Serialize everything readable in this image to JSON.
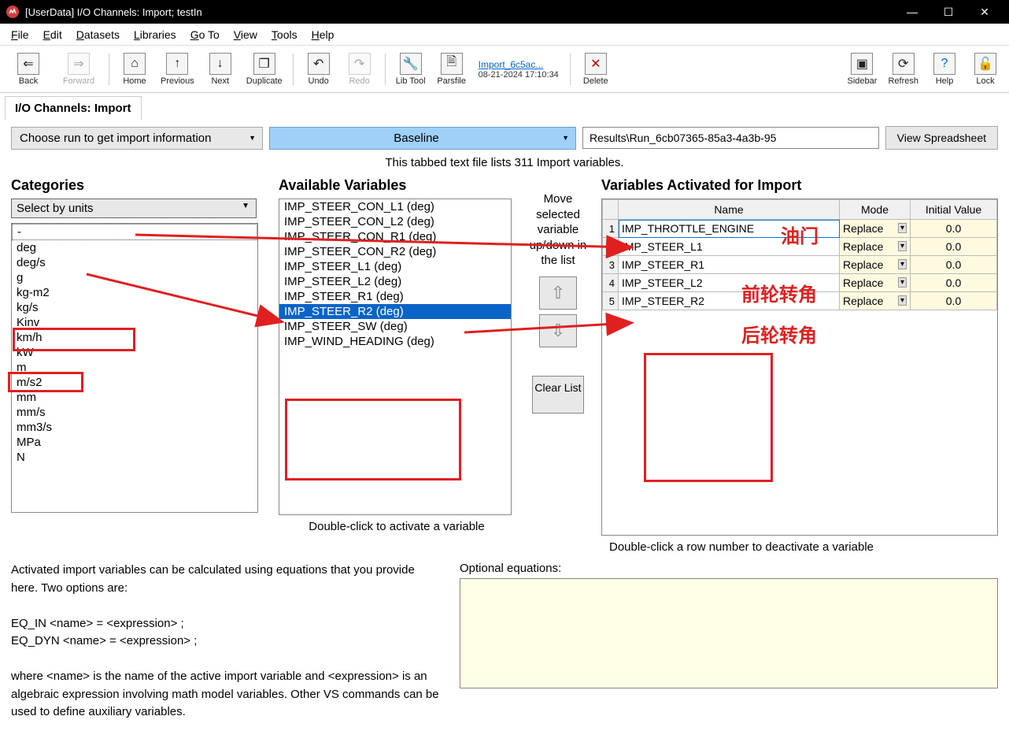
{
  "titlebar": {
    "title": "[UserData] I/O Channels: Import; testIn"
  },
  "menubar": [
    "File",
    "Edit",
    "Datasets",
    "Libraries",
    "Go To",
    "View",
    "Tools",
    "Help"
  ],
  "toolbar": {
    "back": "Back",
    "forward": "Forward",
    "home": "Home",
    "previous": "Previous",
    "next": "Next",
    "duplicate": "Duplicate",
    "undo": "Undo",
    "redo": "Redo",
    "libtool": "Lib Tool",
    "parsfile": "Parsfile",
    "recent_name": "Import_6c5ac...",
    "recent_date": "08-21-2024 17:10:34",
    "delete": "Delete",
    "sidebar": "Sidebar",
    "refresh": "Refresh",
    "help": "Help",
    "lock": "Lock"
  },
  "tab_title": "I/O Channels: Import",
  "top": {
    "choose_run": "Choose run to get import information",
    "baseline": "Baseline",
    "path": "Results\\Run_6cb07365-85a3-4a3b-95",
    "view_btn": "View Spreadsheet"
  },
  "info_line": "This tabbed text file lists 311 Import variables.",
  "categories": {
    "title": "Categories",
    "select_by": "Select by units",
    "units": [
      "-",
      "deg",
      "deg/s",
      "g",
      "kg-m2",
      "kg/s",
      "Kinv",
      "km/h",
      "kW",
      "m",
      "m/s2",
      "mm",
      "mm/s",
      "mm3/s",
      "MPa",
      "N"
    ]
  },
  "available": {
    "title": "Available Variables",
    "items": [
      "IMP_STEER_CON_L1 (deg)",
      "IMP_STEER_CON_L2 (deg)",
      "IMP_STEER_CON_R1 (deg)",
      "IMP_STEER_CON_R2 (deg)",
      "IMP_STEER_L1 (deg)",
      "IMP_STEER_L2 (deg)",
      "IMP_STEER_R1 (deg)",
      "IMP_STEER_R2 (deg)",
      "IMP_STEER_SW (deg)",
      "IMP_WIND_HEADING (deg)"
    ],
    "selected_index": 7,
    "hint": "Double-click to activate a variable"
  },
  "move": {
    "text": "Move selected variable up/down in the list",
    "clear": "Clear List"
  },
  "activated": {
    "title": "Variables Activated for Import",
    "headers": {
      "name": "Name",
      "mode": "Mode",
      "init": "Initial Value"
    },
    "rows": [
      {
        "n": "1",
        "name": "IMP_THROTTLE_ENGINE",
        "mode": "Replace",
        "init": "0.0"
      },
      {
        "n": "2",
        "name": "IMP_STEER_L1",
        "mode": "Replace",
        "init": "0.0"
      },
      {
        "n": "3",
        "name": "IMP_STEER_R1",
        "mode": "Replace",
        "init": "0.0"
      },
      {
        "n": "4",
        "name": "IMP_STEER_L2",
        "mode": "Replace",
        "init": "0.0"
      },
      {
        "n": "5",
        "name": "IMP_STEER_R2",
        "mode": "Replace",
        "init": "0.0"
      }
    ],
    "hint": "Double-click a row number to deactivate a variable"
  },
  "bottom": {
    "text1": "Activated import variables can be calculated using equations that you provide here. Two options are:",
    "text2": "EQ_IN <name> = <expression> ;",
    "text3": "EQ_DYN <name> = <expression> ;",
    "text4": "where <name> is the name of the active import variable and <expression> is an algebraic expression involving math model variables. Other VS commands can be used to define auxiliary variables.",
    "opt_label": "Optional equations:"
  },
  "annotations": {
    "a1": "油门",
    "a2": "前轮转角",
    "a3": "后轮转角"
  }
}
